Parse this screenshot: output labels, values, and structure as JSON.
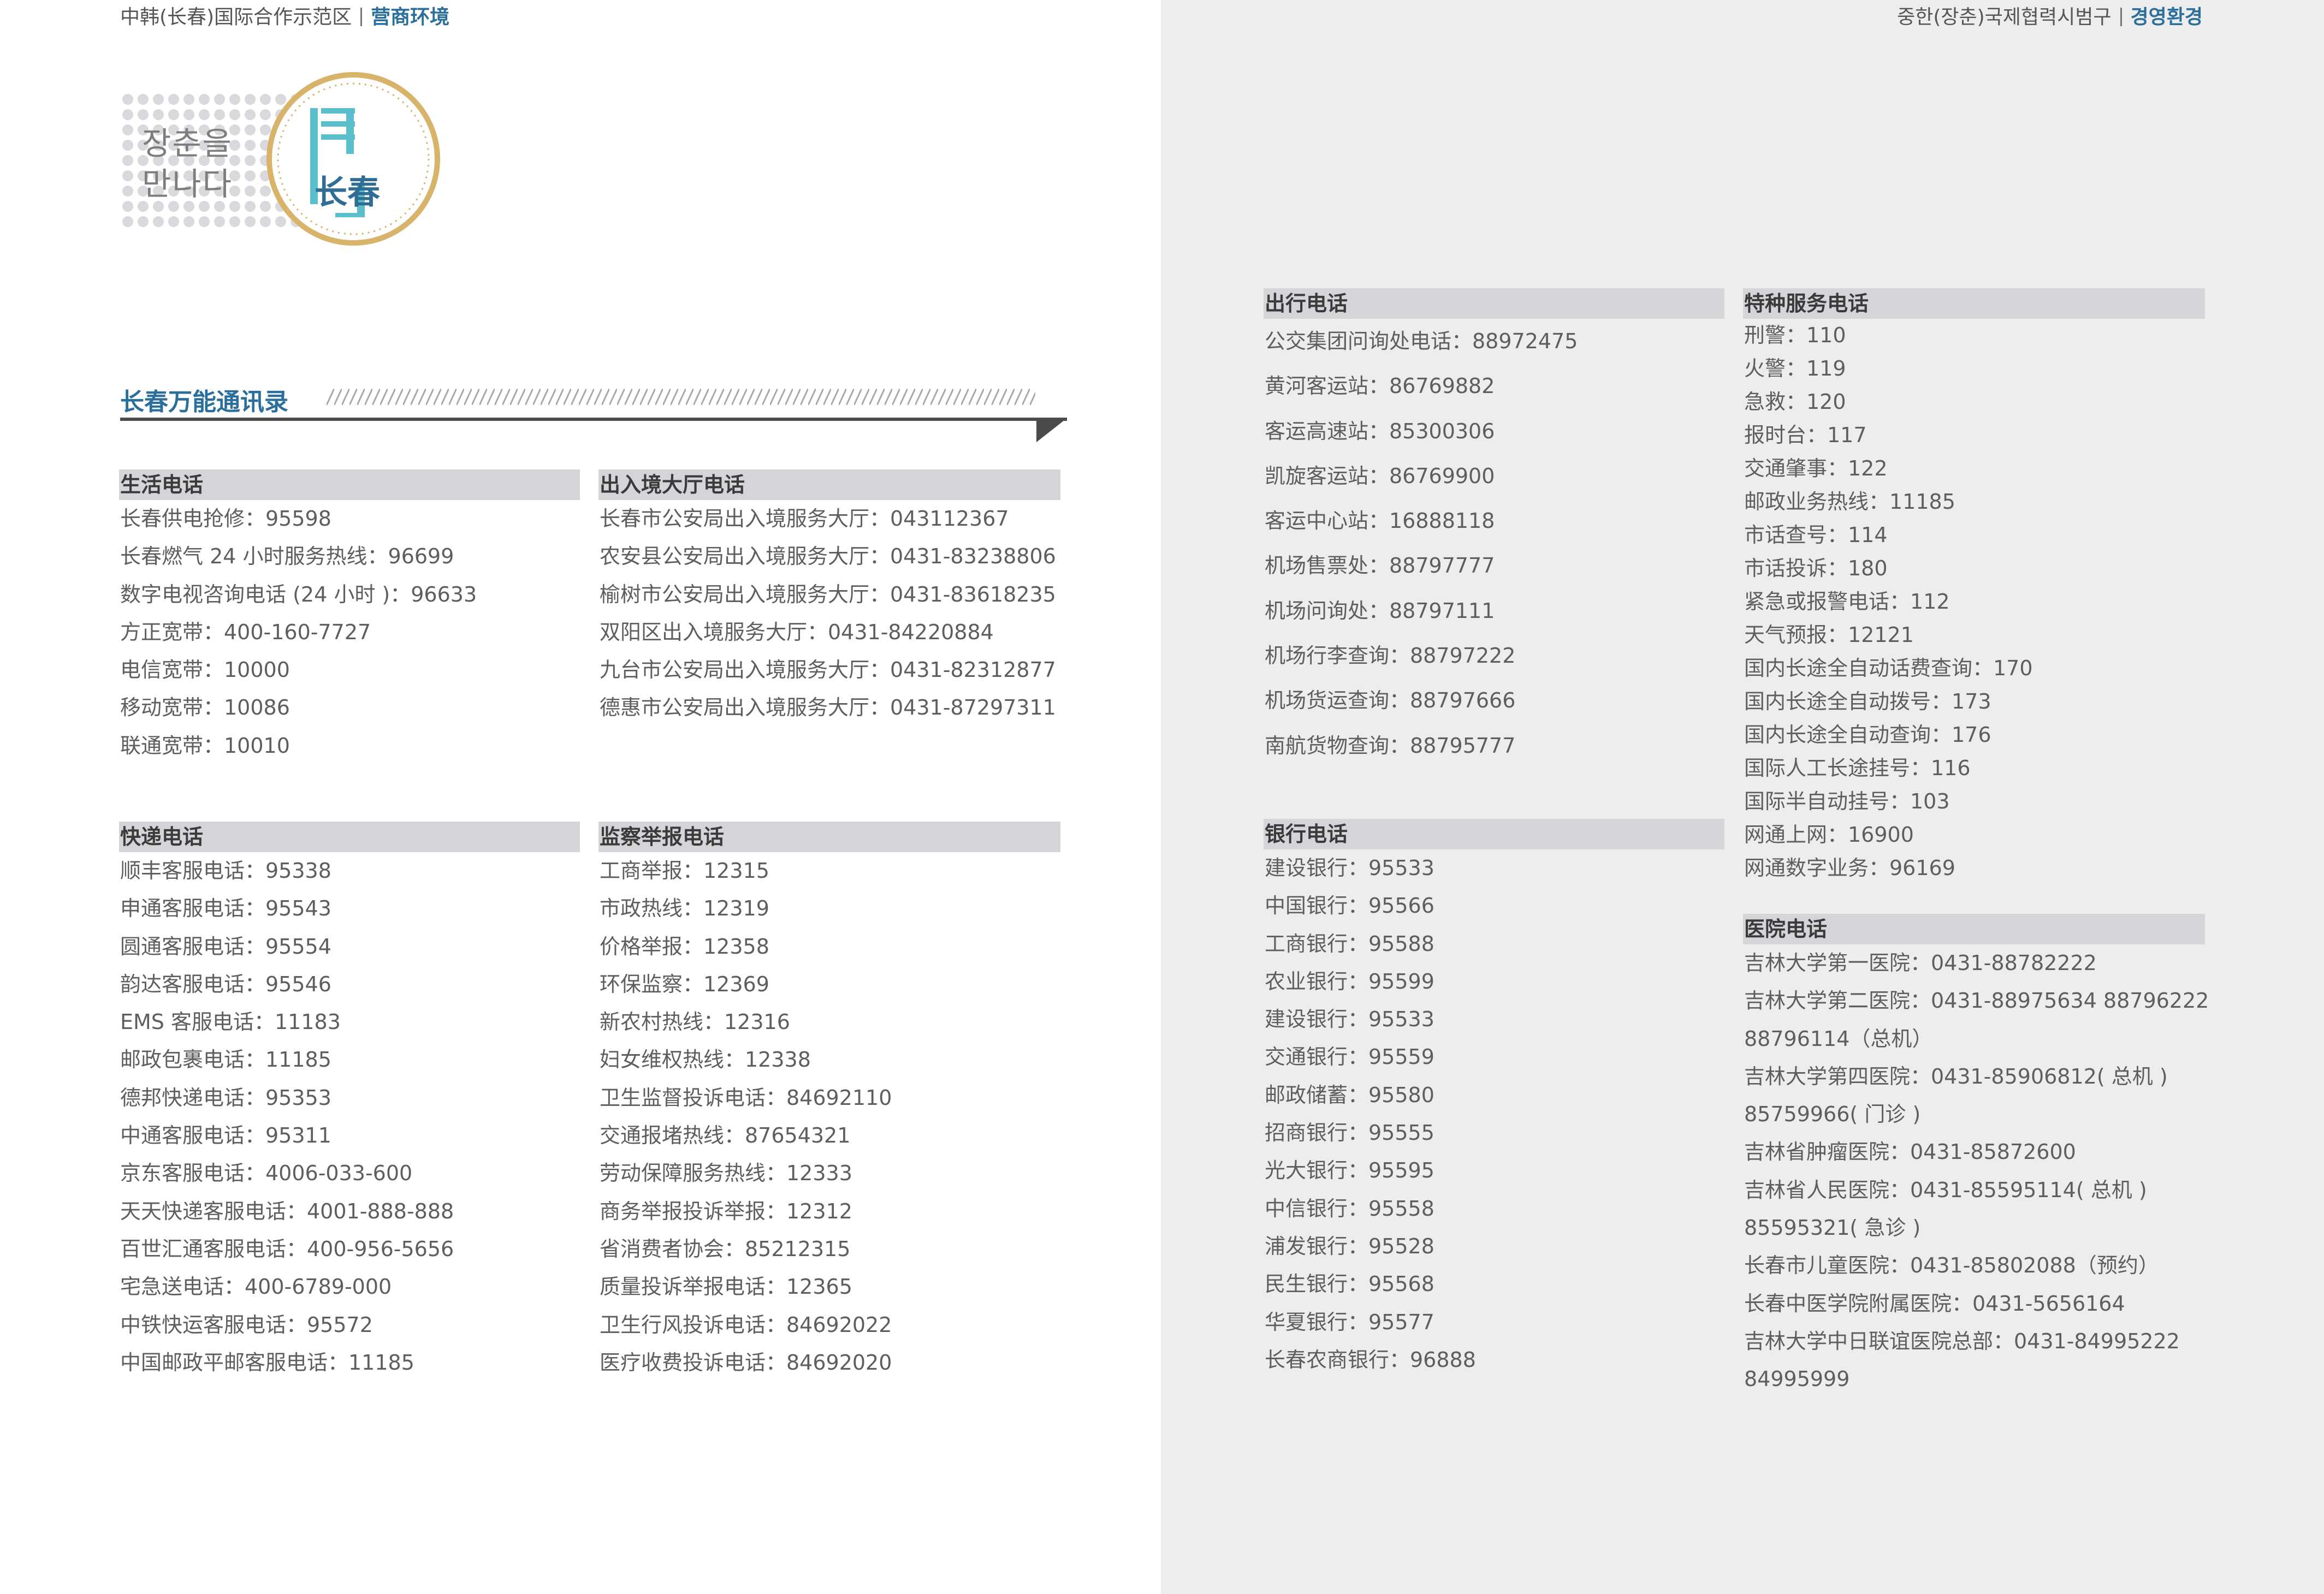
{
  "header_left": {
    "org": "中韩(长春)国际合作示范区",
    "section": "营商环境"
  },
  "header_right": {
    "org": "중한(장춘)국제협력시범구",
    "section": "경영환경"
  },
  "logo": {
    "korean_line1": "장춘을",
    "korean_line2": "만나다",
    "chinese": "长春"
  },
  "directory_title": "长春万能通讯录",
  "sections": [
    {
      "title": "生活电话",
      "entries": [
        "长春供电抢修：95598",
        "长春燃气 24 小时服务热线：96699",
        "数字电视咨询电话 (24 小时 )：96633",
        "方正宽带：400-160-7727",
        "电信宽带：10000",
        "移动宽带：10086",
        "联通宽带：10010"
      ]
    },
    {
      "title": "出入境大厅电话",
      "entries": [
        "长春市公安局出入境服务大厅：043112367",
        "农安县公安局出入境服务大厅：0431-83238806",
        "榆树市公安局出入境服务大厅：0431-83618235",
        "双阳区出入境服务大厅：0431-84220884",
        "九台市公安局出入境服务大厅：0431-82312877",
        "德惠市公安局出入境服务大厅：0431-87297311"
      ]
    },
    {
      "title": "快递电话",
      "entries": [
        "顺丰客服电话：95338",
        "申通客服电话：95543",
        "圆通客服电话：95554",
        "韵达客服电话：95546",
        "EMS 客服电话：11183",
        "邮政包裹电话：11185",
        "德邦快递电话：95353",
        "中通客服电话：95311",
        "京东客服电话：4006-033-600",
        "天天快递客服电话：4001-888-888",
        "百世汇通客服电话：400-956-5656",
        "宅急送电话：400-6789-000",
        "中铁快运客服电话：95572",
        "中国邮政平邮客服电话：11185"
      ]
    },
    {
      "title": "监察举报电话",
      "entries": [
        "工商举报：12315",
        "市政热线：12319",
        "价格举报：12358",
        "环保监察：12369",
        "新农村热线：12316",
        "妇女维权热线：12338",
        "卫生监督投诉电话：84692110",
        "交通报堵热线：87654321",
        "劳动保障服务热线：12333",
        "商务举报投诉举报：12312",
        "省消费者协会：85212315",
        "质量投诉举报电话：12365",
        "卫生行风投诉电话：84692022",
        "医疗收费投诉电话：84692020"
      ]
    },
    {
      "title": "出行电话",
      "entries": [
        "公交集团问询处电话：88972475",
        "黄河客运站：86769882",
        "客运高速站：85300306",
        "凯旋客运站：86769900",
        "客运中心站：16888118",
        "机场售票处：88797777",
        "机场问询处：88797111",
        "机场行李查询：88797222",
        "机场货运查询：88797666",
        "南航货物查询：88795777"
      ]
    },
    {
      "title": "银行电话",
      "entries": [
        "建设银行：95533",
        "中国银行：95566",
        "工商银行：95588",
        "农业银行：95599",
        "建设银行：95533",
        "交通银行：95559",
        "邮政储蓄：95580",
        "招商银行：95555",
        "光大银行：95595",
        "中信银行：95558",
        "浦发银行：95528",
        "民生银行：95568",
        "华夏银行：95577",
        "长春农商银行：96888"
      ]
    },
    {
      "title": "特种服务电话",
      "entries": [
        "刑警：110",
        "火警：119",
        "急救：120",
        "报时台：117",
        "交通肇事：122",
        "邮政业务热线：11185",
        "市话查号：114",
        "市话投诉：180",
        "紧急或报警电话：112",
        "天气预报：12121",
        "国内长途全自动话费查询：170",
        "国内长途全自动拨号：173",
        "国内长途全自动查询：176",
        "国际人工长途挂号：116",
        "国际半自动挂号：103",
        "网通上网：16900",
        "网通数字业务：96169"
      ]
    },
    {
      "title": "医院电话",
      "entries": [
        "吉林大学第一医院：0431-88782222",
        "吉林大学第二医院：0431-88975634  88796222",
        "88796114（总机）",
        "吉林大学第四医院：0431-85906812( 总机 )",
        "85759966( 门诊 )",
        "吉林省肿瘤医院：0431-85872600",
        "吉林省人民医院：0431-85595114( 总机 )",
        "85595321( 急诊 )",
        "长春市儿童医院：0431-85802088（预约）",
        "长春中医学院附属医院：0431-5656164",
        "吉林大学中日联谊医院总部：0431-84995222",
        "84995999"
      ]
    }
  ]
}
